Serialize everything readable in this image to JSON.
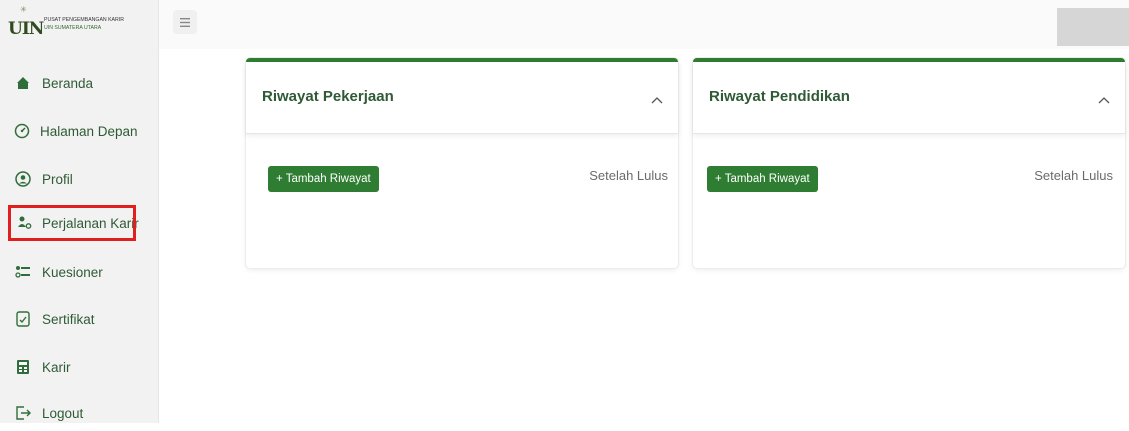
{
  "logo": {
    "mark": "UIN",
    "line1": "PUSAT PENGEMBANGAN KARIR",
    "line2": "UIN SUMATERA UTARA"
  },
  "sidebar": {
    "items": [
      {
        "label": "Beranda",
        "icon": "home-icon"
      },
      {
        "label": "Halaman Depan",
        "icon": "dashboard-icon"
      },
      {
        "label": "Profil",
        "icon": "user-circle-icon"
      },
      {
        "label": "Perjalanan Karir",
        "icon": "career-path-icon",
        "selected": true
      },
      {
        "label": "Kuesioner",
        "icon": "questionnaire-icon"
      },
      {
        "label": "Sertifikat",
        "icon": "certificate-icon"
      },
      {
        "label": "Karir",
        "icon": "career-icon"
      },
      {
        "label": "Logout",
        "icon": "logout-icon"
      }
    ]
  },
  "topbar": {
    "menu_icon": "hamburger-icon"
  },
  "cards": [
    {
      "title": "Riwayat Pekerjaan",
      "button": "+ Tambah Riwayat",
      "status": "Setelah Lulus"
    },
    {
      "title": "Riwayat Pendidikan",
      "button": "+ Tambah Riwayat",
      "status": "Setelah Lulus"
    }
  ],
  "colors": {
    "accent": "#2e7d32",
    "sidebar_bg": "#f2f2f2",
    "highlight": "#e0201f"
  }
}
